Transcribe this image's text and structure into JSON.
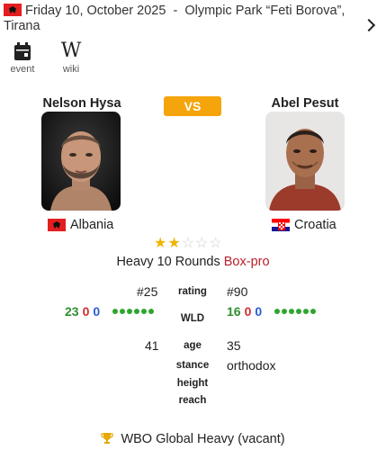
{
  "event": {
    "date": "Friday 10, October 2025",
    "separator": "-",
    "venue": "Olympic Park “Feti Borova”, Tirana"
  },
  "links": [
    {
      "icon": "calendar-icon",
      "label": "event"
    },
    {
      "icon": "wikipedia-icon",
      "label": "wiki"
    }
  ],
  "vs_label": "VS",
  "fighter1": {
    "name": "Nelson Hysa",
    "country": "Albania",
    "rank": "#25",
    "wins": "23",
    "losses": "0",
    "draws": "0",
    "age": "41",
    "stance": "",
    "height": "",
    "reach": ""
  },
  "fighter2": {
    "name": "Abel Pesut",
    "country": "Croatia",
    "rank": "#90",
    "wins": "16",
    "losses": "0",
    "draws": "0",
    "age": "35",
    "stance": "orthodox",
    "height": "",
    "reach": ""
  },
  "rating_stars": 2,
  "rating_max": 5,
  "fight": {
    "details": "Heavy 10 Rounds",
    "type": "Box-pro"
  },
  "labels": {
    "rating": "rating",
    "wld": "WLD",
    "age": "age",
    "stance": "stance",
    "height": "height",
    "reach": "reach"
  },
  "title_belt": "WBO Global Heavy (vacant)",
  "colors": {
    "vs_badge": "#f5a50b",
    "win": "#2f8f2f",
    "loss": "#d22d2d",
    "draw": "#2a5bd7",
    "fight_type": "#b8202a",
    "star": "#f0b400"
  }
}
